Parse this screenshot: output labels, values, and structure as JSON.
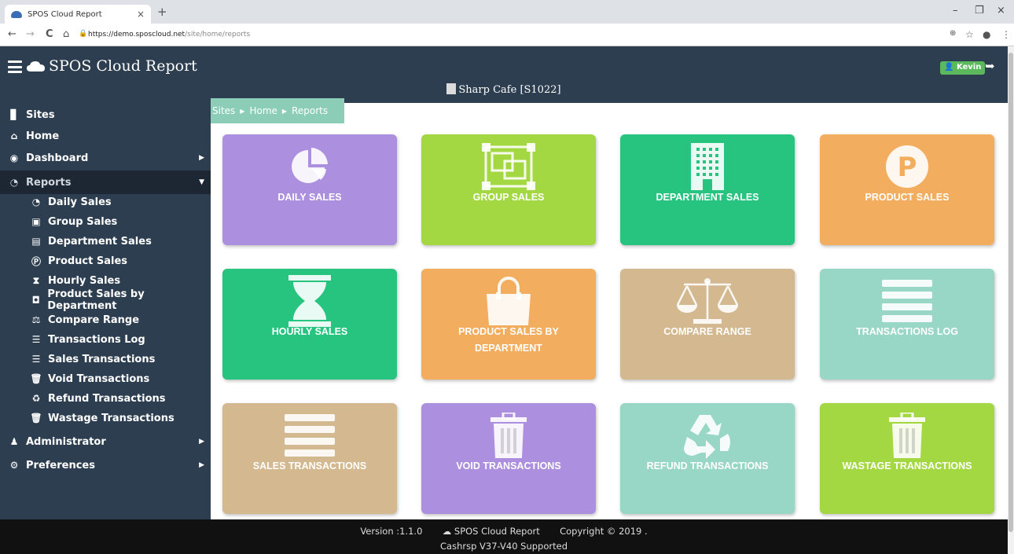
{
  "browser": {
    "tab_title": "SPOS Cloud Report",
    "tab_close": "×",
    "new_tab": "+",
    "url_host": "https://demo.sposcloud.net",
    "url_path": "/site/home/reports",
    "nav_back": "←",
    "nav_forward": "→",
    "nav_reload": "C",
    "nav_home": "⌂",
    "win_min": "–",
    "win_max": "❐",
    "win_close": "×"
  },
  "header": {
    "title": "SPOS Cloud Report",
    "site_name": "Sharp Cafe [S1022]",
    "user": "Kevin",
    "logout_icon": "logout-icon"
  },
  "breadcrumb": [
    "Sites",
    "Home",
    "Reports"
  ],
  "sidebar": {
    "top": [
      {
        "label": "Sites",
        "icon": "building-icon"
      },
      {
        "label": "Home",
        "icon": "home-icon"
      },
      {
        "label": "Dashboard",
        "icon": "dashboard-icon"
      },
      {
        "label": "Reports",
        "icon": "pie-chart-icon"
      }
    ],
    "reports": [
      {
        "label": "Daily Sales",
        "icon": "pie-chart-icon"
      },
      {
        "label": "Group Sales",
        "icon": "object-group-icon"
      },
      {
        "label": "Department Sales",
        "icon": "building-icon"
      },
      {
        "label": "Product Sales",
        "icon": "product-p-icon"
      },
      {
        "label": "Hourly Sales",
        "icon": "hourglass-icon"
      },
      {
        "label": "Product Sales by Department",
        "icon": "shopping-bag-icon"
      },
      {
        "label": "Compare Range",
        "icon": "balance-scale-icon"
      },
      {
        "label": "Transactions Log",
        "icon": "list-icon"
      },
      {
        "label": "Sales Transactions",
        "icon": "list-icon"
      },
      {
        "label": "Void Transactions",
        "icon": "trash-icon"
      },
      {
        "label": "Refund Transactions",
        "icon": "recycle-icon"
      },
      {
        "label": "Wastage Transactions",
        "icon": "trash-icon"
      }
    ],
    "bottom": [
      {
        "label": "Administrator",
        "icon": "user-icon"
      },
      {
        "label": "Preferences",
        "icon": "cog-icon"
      }
    ]
  },
  "tiles": [
    {
      "label": "DAILY SALES",
      "color": "#ac8fdf",
      "icon": "pie-chart-icon"
    },
    {
      "label": "GROUP SALES",
      "color": "#a3d843",
      "icon": "object-group-icon"
    },
    {
      "label": "DEPARTMENT SALES",
      "color": "#27c480",
      "icon": "building-icon"
    },
    {
      "label": "PRODUCT SALES",
      "color": "#f2ad5e",
      "icon": "product-p-icon"
    },
    {
      "label": "HOURLY SALES",
      "color": "#27c480",
      "icon": "hourglass-icon"
    },
    {
      "label": "PRODUCT SALES BY DEPARTMENT",
      "color": "#f2ad5e",
      "icon": "shopping-bag-icon"
    },
    {
      "label": "COMPARE RANGE",
      "color": "#d3b890",
      "icon": "balance-scale-icon"
    },
    {
      "label": "TRANSACTIONS LOG",
      "color": "#98d6c5",
      "icon": "list-icon"
    },
    {
      "label": "SALES TRANSACTIONS",
      "color": "#d3b890",
      "icon": "list-icon"
    },
    {
      "label": "VOID TRANSACTIONS",
      "color": "#ac8fdf",
      "icon": "trash-icon"
    },
    {
      "label": "REFUND TRANSACTIONS",
      "color": "#98d6c5",
      "icon": "recycle-icon"
    },
    {
      "label": "WASTAGE TRANSACTIONS",
      "color": "#a3d843",
      "icon": "trash-icon"
    }
  ],
  "footer": {
    "version": "Version :1.1.0",
    "app_name": "SPOS Cloud Report",
    "copyright": "Copyright © 2019 .",
    "supported": "Cashrsp V37-V40 Supported"
  }
}
